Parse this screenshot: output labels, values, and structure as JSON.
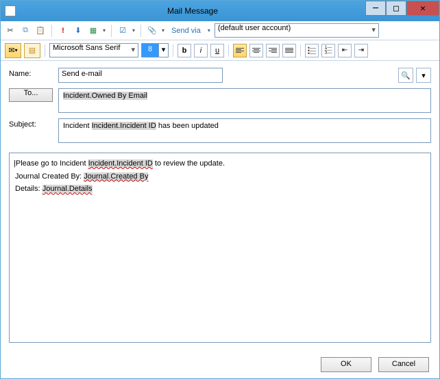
{
  "window": {
    "title": "Mail Message"
  },
  "toolbar1": {
    "send_via_label": "Send via",
    "account_selected": "(default user account)"
  },
  "toolbar2": {
    "font_name": "Microsoft Sans Serif",
    "font_size": "8"
  },
  "form": {
    "name_label": "Name:",
    "name_value": "Send e-mail",
    "to_label": "To...",
    "to_value_token": "Incident.Owned By Email",
    "subject_label": "Subject:",
    "subject_prefix": "Incident ",
    "subject_token": "Incident.Incident ID",
    "subject_suffix": " has been updated"
  },
  "body": {
    "line1_prefix": "Please go to Incident ",
    "line1_token": "Incident.Incident ID",
    "line1_suffix": " to review the update.",
    "line2_prefix": "Journal Created By: ",
    "line2_token": "Journal.Created By",
    "line3_prefix": "Details: ",
    "line3_token": "Journal.Details"
  },
  "buttons": {
    "ok": "OK",
    "cancel": "Cancel"
  }
}
